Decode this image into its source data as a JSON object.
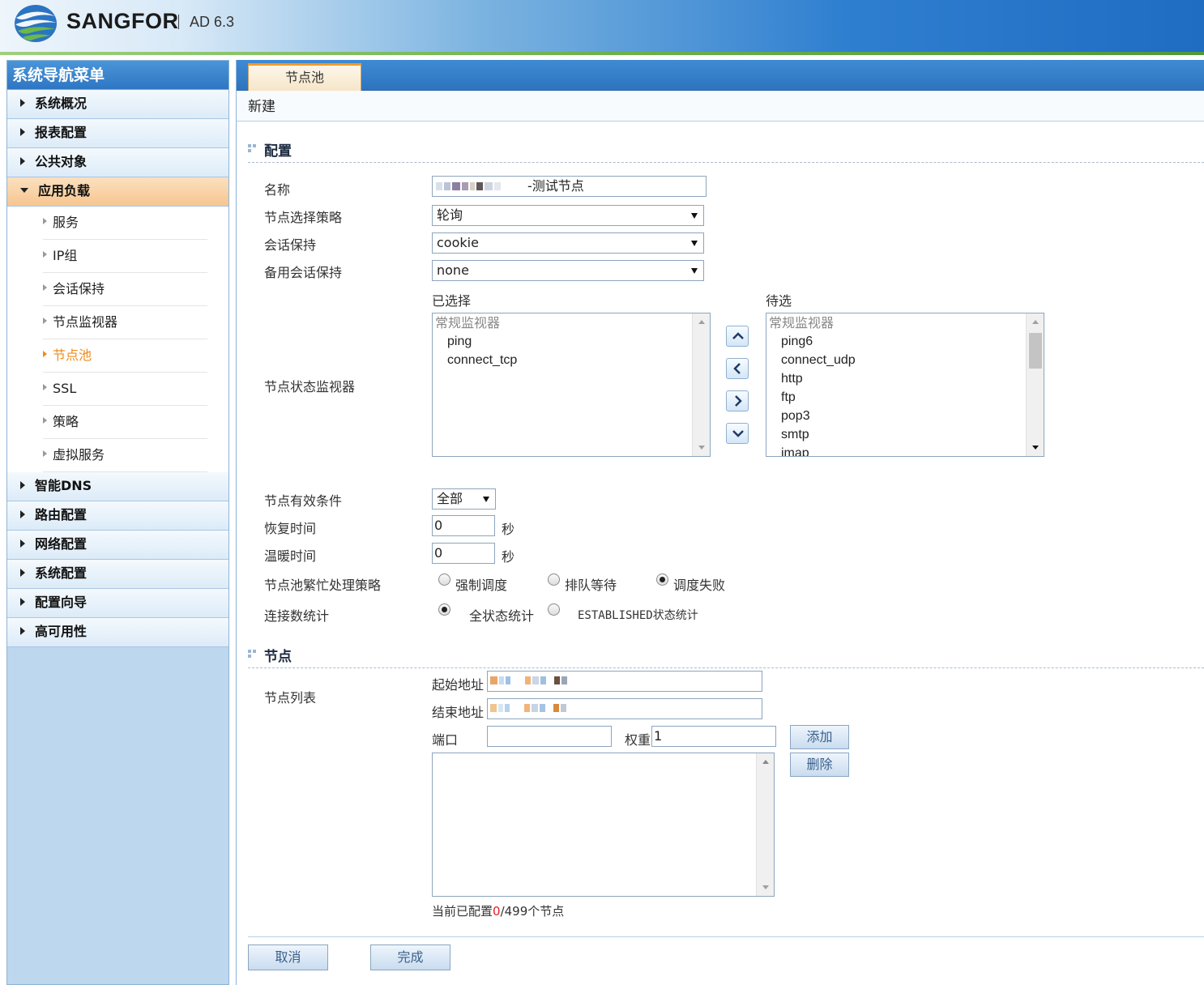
{
  "app": {
    "brand": "SANGFOR",
    "version": "AD 6.3"
  },
  "sidebar": {
    "title": "系统导航菜单",
    "items_top": [
      {
        "label": "系统概况"
      },
      {
        "label": "报表配置"
      },
      {
        "label": "公共对象"
      }
    ],
    "active_item": {
      "label": "应用负载"
    },
    "sub_items": [
      {
        "label": "服务"
      },
      {
        "label": "IP组"
      },
      {
        "label": "会话保持"
      },
      {
        "label": "节点监视器"
      },
      {
        "label": "节点池"
      },
      {
        "label": "SSL"
      },
      {
        "label": "策略"
      },
      {
        "label": "虚拟服务"
      }
    ],
    "items_bottom": [
      {
        "label": "智能DNS"
      },
      {
        "label": "路由配置"
      },
      {
        "label": "网络配置"
      },
      {
        "label": "系统配置"
      },
      {
        "label": "配置向导"
      },
      {
        "label": "高可用性"
      }
    ]
  },
  "tab": {
    "label": "节点池"
  },
  "breadcrumb": "新建",
  "config": {
    "section_title": "配置",
    "name_label": "名称",
    "name_value": "-测试节点",
    "strategy_label": "节点选择策略",
    "strategy_value": "轮询",
    "session_label": "会话保持",
    "session_value": "cookie",
    "backup_session_label": "备用会话保持",
    "backup_session_value": "none",
    "selected_label": "已选择",
    "available_label": "待选",
    "monitor_label": "节点状态监视器",
    "selected_group": "常规监视器",
    "selected_options": [
      "ping",
      "connect_tcp"
    ],
    "available_group": "常规监视器",
    "available_options": [
      "ping6",
      "connect_udp",
      "http",
      "ftp",
      "pop3",
      "smtp",
      "imap"
    ],
    "valid_condition_label": "节点有效条件",
    "valid_condition_value": "全部",
    "recover_label": "恢复时间",
    "recover_value": "0",
    "recover_unit": "秒",
    "warmup_label": "温暖时间",
    "warmup_value": "0",
    "warmup_unit": "秒",
    "busy_label": "节点池繁忙处理策略",
    "busy_options": [
      "强制调度",
      "排队等待",
      "调度失败"
    ],
    "busy_selected": "调度失败",
    "conn_label": "连接数统计",
    "conn_options": [
      "全状态统计",
      "ESTABLISHED状态统计"
    ],
    "conn_selected": "全状态统计"
  },
  "nodes": {
    "section_title": "节点",
    "list_label": "节点列表",
    "start_label": "起始地址",
    "end_label": "结束地址",
    "port_label": "端口",
    "port_value": "",
    "weight_label": "权重",
    "weight_value": "1",
    "add_button": "添加",
    "delete_button": "删除",
    "status_prefix": "当前已配置",
    "status_count": "0",
    "status_suffix": "/499个节点"
  },
  "footer": {
    "cancel_button": "取消",
    "finish_button": "完成"
  },
  "colors": {
    "accent_orange": "#f08a1a",
    "header_blue": "#2d73bf",
    "sidebar_bg": "#bcd7ee",
    "count_red": "#e02020"
  }
}
